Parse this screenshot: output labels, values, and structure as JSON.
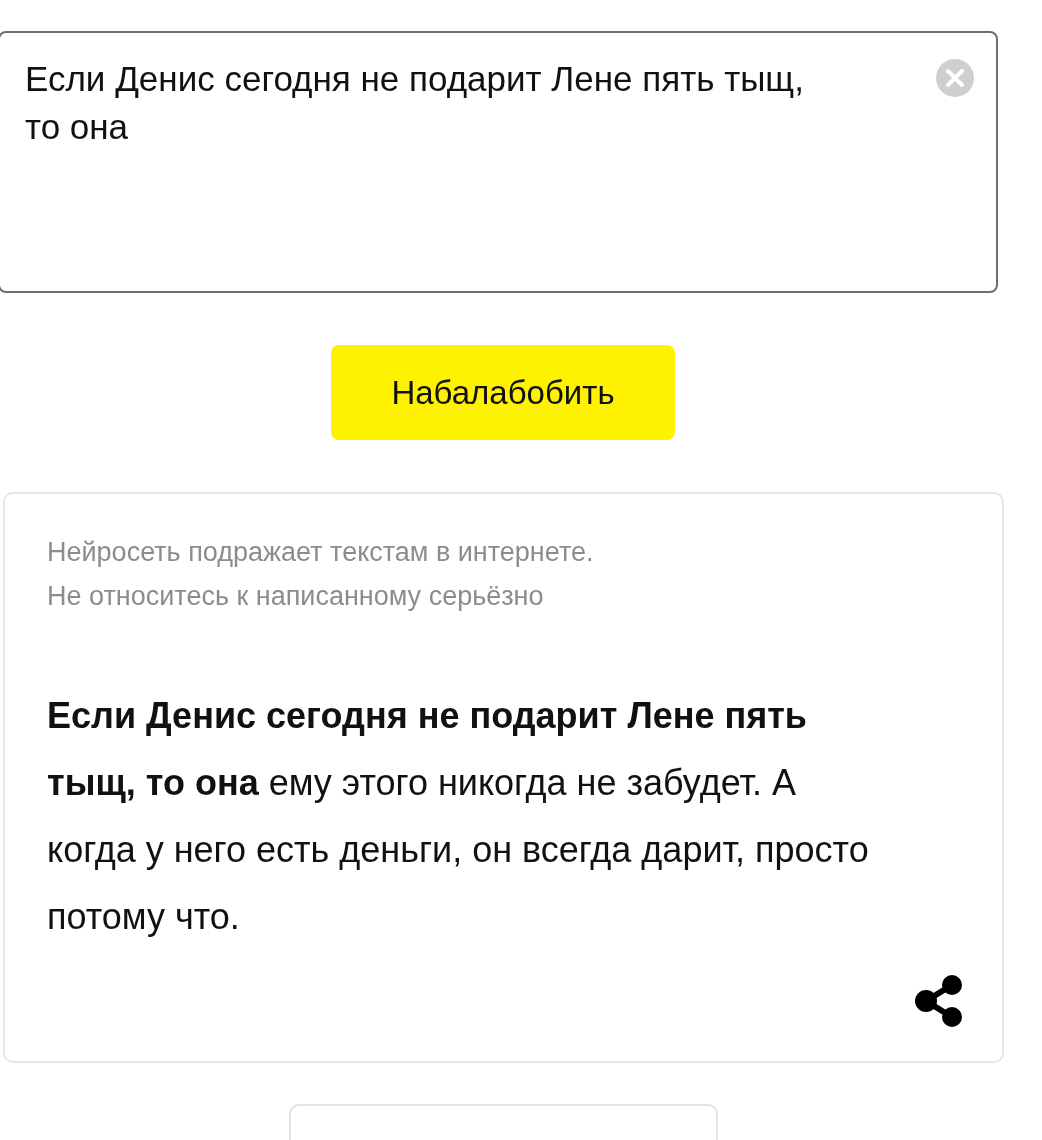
{
  "input": {
    "value": "Если Денис сегодня не подарит Лене пять тыщ, то она"
  },
  "generate_button": {
    "label": "Набалабобить"
  },
  "result": {
    "disclaimer": [
      "Нейросеть подражает текстам в интернете.",
      "Не относитесь к написанному серьёзно"
    ],
    "text": "**Если Денис сегодня не подарит Лене пять тыщ, то она** ему этого никогда не забудет. А когда у него есть деньги, он всегда дарит, просто потому что."
  }
}
